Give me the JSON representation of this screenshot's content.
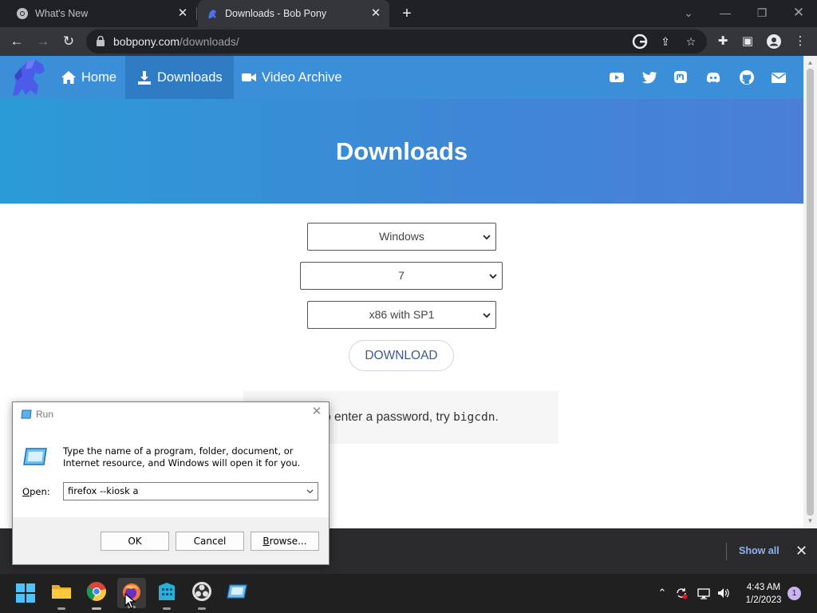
{
  "browser": {
    "tabs": [
      {
        "title": "What's New",
        "active": false
      },
      {
        "title": "Downloads - Bob Pony",
        "active": true
      }
    ],
    "url_host": "bobpony.com",
    "url_path": "/downloads/"
  },
  "site": {
    "nav": [
      {
        "label": "Home",
        "icon": "home-icon"
      },
      {
        "label": "Downloads",
        "icon": "download-icon"
      },
      {
        "label": "Video Archive",
        "icon": "video-camera-icon"
      }
    ],
    "social_icons": [
      "youtube-icon",
      "twitter-icon",
      "mastodon-icon",
      "discord-icon",
      "github-icon",
      "email-icon"
    ],
    "hero_title": "Downloads",
    "os_select": "Windows",
    "version_select": "7",
    "edition_select": "x86 with SP1",
    "download_button": "DOWNLOAD",
    "notice_text": "ed to enter a password, try ",
    "notice_code": "bigcdn",
    "notice_end": ".",
    "colors": {
      "header": "#3b8ed8",
      "hero_start": "#2b9bd6",
      "hero_end": "#4a7fd5"
    }
  },
  "download_bar": {
    "show_all": "Show all"
  },
  "run_dialog": {
    "title": "Run",
    "description": "Type the name of a program, folder, document, or Internet resource, and Windows will open it for you.",
    "open_label_underlined": "O",
    "open_label_rest": "pen:",
    "open_value": "firefox --kiosk a",
    "ok": "OK",
    "cancel": "Cancel",
    "browse_underlined": "B",
    "browse_rest": "rowse..."
  },
  "taskbar": {
    "time": "4:43 AM",
    "date": "1/2/2023",
    "notification_count": "1"
  }
}
